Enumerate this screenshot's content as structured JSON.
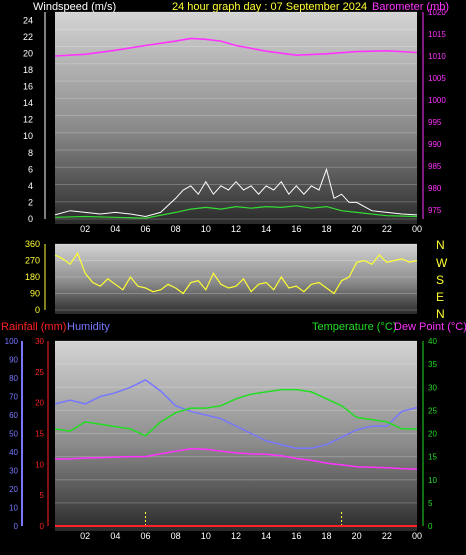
{
  "header": {
    "left": "Windspeed (m/s)",
    "center": "24 hour graph day : 07 September 2024",
    "right": "Barometer (mb)"
  },
  "colors": {
    "background": "#000000",
    "windspeed": "#ffffff",
    "windavg": "#33dd33",
    "barometer": "#ff33ff",
    "direction": "#ffff33",
    "rainfall": "#ff2222",
    "humidity": "#7777ff",
    "temperature": "#22dd22",
    "dewpoint": "#ff33ff",
    "header_left": "#ffffff",
    "header_center": "#ffff33",
    "header_right": "#ff33ff"
  },
  "x_ticks": [
    "02",
    "04",
    "06",
    "08",
    "10",
    "12",
    "14",
    "16",
    "18",
    "20",
    "22",
    "00"
  ],
  "compass": [
    "N",
    "W",
    "S",
    "E",
    "N"
  ],
  "bottom_legend": {
    "rainfall": "Rainfall (mm)",
    "humidity": "Humidity",
    "temperature": "Temperature (°C)",
    "dewpoint": "Dew Point (°C)"
  },
  "chart_data": [
    {
      "type": "line",
      "title": "24 hour graph day : 07 September 2024",
      "xlabel": "",
      "x_ticks": [
        "02",
        "04",
        "06",
        "08",
        "10",
        "12",
        "14",
        "16",
        "18",
        "20",
        "22",
        "00"
      ],
      "y_left": {
        "label": "Windspeed (m/s)",
        "ylim": [
          0,
          25
        ],
        "ticks": [
          "0",
          "2",
          "4",
          "6",
          "8",
          "10",
          "12",
          "14",
          "16",
          "18",
          "20",
          "22",
          "24"
        ]
      },
      "y_right": {
        "label": "Barometer (mb)",
        "ylim": [
          973,
          1020
        ],
        "ticks": [
          "975",
          "980",
          "985",
          "990",
          "995",
          "1000",
          "1005",
          "1010",
          "1015",
          "1020"
        ]
      },
      "series": [
        {
          "name": "Barometer (mb)",
          "axis": "right",
          "x": [
            0,
            2,
            4,
            6,
            8,
            9,
            10,
            11,
            12,
            14,
            16,
            18,
            20,
            22,
            24
          ],
          "values": [
            1010.0,
            1010.4,
            1011.3,
            1012.4,
            1013.4,
            1014.0,
            1013.8,
            1013.4,
            1012.4,
            1011.1,
            1010.2,
            1010.5,
            1011.0,
            1011.2,
            1010.8
          ]
        },
        {
          "name": "Windspeed (m/s)",
          "axis": "left",
          "x": [
            0,
            1,
            2,
            3,
            4,
            5,
            6,
            7,
            8,
            8.5,
            9,
            9.5,
            10,
            10.5,
            11,
            11.5,
            12,
            12.5,
            13,
            13.5,
            14,
            14.5,
            15,
            15.5,
            16,
            16.5,
            17,
            17.5,
            18,
            18.5,
            19,
            19.5,
            20,
            21,
            22,
            23,
            24
          ],
          "values": [
            0.5,
            1.0,
            0.8,
            0.6,
            0.8,
            0.6,
            0.3,
            0.8,
            2.5,
            3.5,
            4.0,
            3.0,
            4.5,
            3.0,
            4.0,
            3.5,
            4.5,
            3.5,
            4.0,
            3.0,
            4.0,
            3.5,
            4.5,
            3.0,
            4.0,
            3.0,
            4.0,
            3.5,
            6.0,
            2.5,
            3.0,
            2.0,
            2.0,
            1.0,
            0.8,
            0.6,
            0.5
          ]
        },
        {
          "name": "Wind average (m/s)",
          "axis": "left",
          "x": [
            0,
            2,
            4,
            6,
            8,
            9,
            10,
            11,
            12,
            13,
            14,
            15,
            16,
            17,
            18,
            19,
            20,
            22,
            24
          ],
          "values": [
            0.2,
            0.3,
            0.2,
            0.1,
            0.8,
            1.2,
            1.4,
            1.2,
            1.5,
            1.3,
            1.5,
            1.4,
            1.6,
            1.3,
            1.5,
            1.0,
            0.8,
            0.4,
            0.3
          ]
        }
      ]
    },
    {
      "type": "line",
      "title": "",
      "ylim": [
        0,
        360
      ],
      "y_ticks": [
        "0",
        "90",
        "180",
        "270",
        "360"
      ],
      "x": [
        0,
        0.5,
        1,
        1.5,
        2,
        2.5,
        3,
        3.5,
        4,
        4.5,
        5,
        5.5,
        6,
        6.5,
        7,
        7.5,
        8,
        8.5,
        9,
        9.5,
        10,
        10.5,
        11,
        11.5,
        12,
        12.5,
        13,
        13.5,
        14,
        14.5,
        15,
        15.5,
        16,
        16.5,
        17,
        17.5,
        18,
        18.5,
        19,
        19.5,
        20,
        20.5,
        21,
        21.5,
        22,
        22.5,
        23,
        23.5,
        24
      ],
      "series": [
        {
          "name": "Wind direction",
          "values": [
            300,
            280,
            250,
            310,
            200,
            150,
            130,
            170,
            140,
            110,
            180,
            130,
            120,
            100,
            110,
            140,
            120,
            90,
            150,
            160,
            110,
            200,
            140,
            120,
            130,
            170,
            100,
            140,
            150,
            110,
            180,
            120,
            130,
            100,
            140,
            150,
            120,
            90,
            160,
            180,
            260,
            270,
            250,
            300,
            260,
            270,
            280,
            260,
            270
          ]
        }
      ]
    },
    {
      "type": "line",
      "title": "",
      "x_ticks": [
        "02",
        "04",
        "06",
        "08",
        "10",
        "12",
        "14",
        "16",
        "18",
        "20",
        "22",
        "00"
      ],
      "y_left_rain": {
        "label": "Rainfall (mm)",
        "ylim": [
          0,
          30
        ],
        "ticks": [
          "0",
          "5",
          "10",
          "15",
          "20",
          "25",
          "30"
        ]
      },
      "y_left_hum": {
        "label": "Humidity",
        "ylim": [
          0,
          100
        ],
        "ticks": [
          "0",
          "10",
          "20",
          "30",
          "40",
          "50",
          "60",
          "70",
          "80",
          "90",
          "100"
        ]
      },
      "y_right": {
        "label": "Temperature (°C)",
        "ylim": [
          0,
          40
        ],
        "ticks": [
          "0",
          "5",
          "10",
          "15",
          "20",
          "25",
          "30",
          "35",
          "40"
        ]
      },
      "series": [
        {
          "name": "Humidity",
          "axis": "hum",
          "x": [
            0,
            1,
            2,
            3,
            4,
            5,
            6,
            7,
            8,
            9,
            10,
            11,
            12,
            13,
            14,
            15,
            16,
            17,
            18,
            19,
            20,
            21,
            22,
            23,
            24
          ],
          "values": [
            66,
            68,
            66,
            70,
            72,
            75,
            79,
            73,
            65,
            62,
            60,
            58,
            54,
            50,
            46,
            44,
            42,
            42,
            44,
            48,
            52,
            54,
            54,
            62,
            64
          ]
        },
        {
          "name": "Temperature (°C)",
          "axis": "temp",
          "x": [
            0,
            1,
            2,
            3,
            4,
            5,
            6,
            7,
            8,
            9,
            10,
            11,
            12,
            13,
            14,
            15,
            16,
            17,
            18,
            19,
            20,
            21,
            22,
            23,
            24
          ],
          "values": [
            21.0,
            20.5,
            22.5,
            22.0,
            21.5,
            21.0,
            19.5,
            22.5,
            24.5,
            25.5,
            25.5,
            26.0,
            27.5,
            28.5,
            29.0,
            29.5,
            29.5,
            29.0,
            27.5,
            26.0,
            23.5,
            23.0,
            22.5,
            21.0,
            21.0
          ]
        },
        {
          "name": "Dew Point (°C)",
          "axis": "temp",
          "x": [
            0,
            1,
            2,
            3,
            4,
            5,
            6,
            7,
            8,
            9,
            10,
            11,
            12,
            13,
            14,
            15,
            16,
            17,
            18,
            19,
            20,
            21,
            22,
            23,
            24
          ],
          "values": [
            14.5,
            14.5,
            14.7,
            14.8,
            14.9,
            15.0,
            15.0,
            15.6,
            16.2,
            16.7,
            16.6,
            16.2,
            15.8,
            15.6,
            15.5,
            15.2,
            14.6,
            14.2,
            13.6,
            13.2,
            12.8,
            12.7,
            12.6,
            12.4,
            12.3
          ]
        },
        {
          "name": "Rainfall (mm)",
          "axis": "rain",
          "x": [
            0,
            24
          ],
          "values": [
            0,
            0
          ]
        }
      ]
    }
  ]
}
